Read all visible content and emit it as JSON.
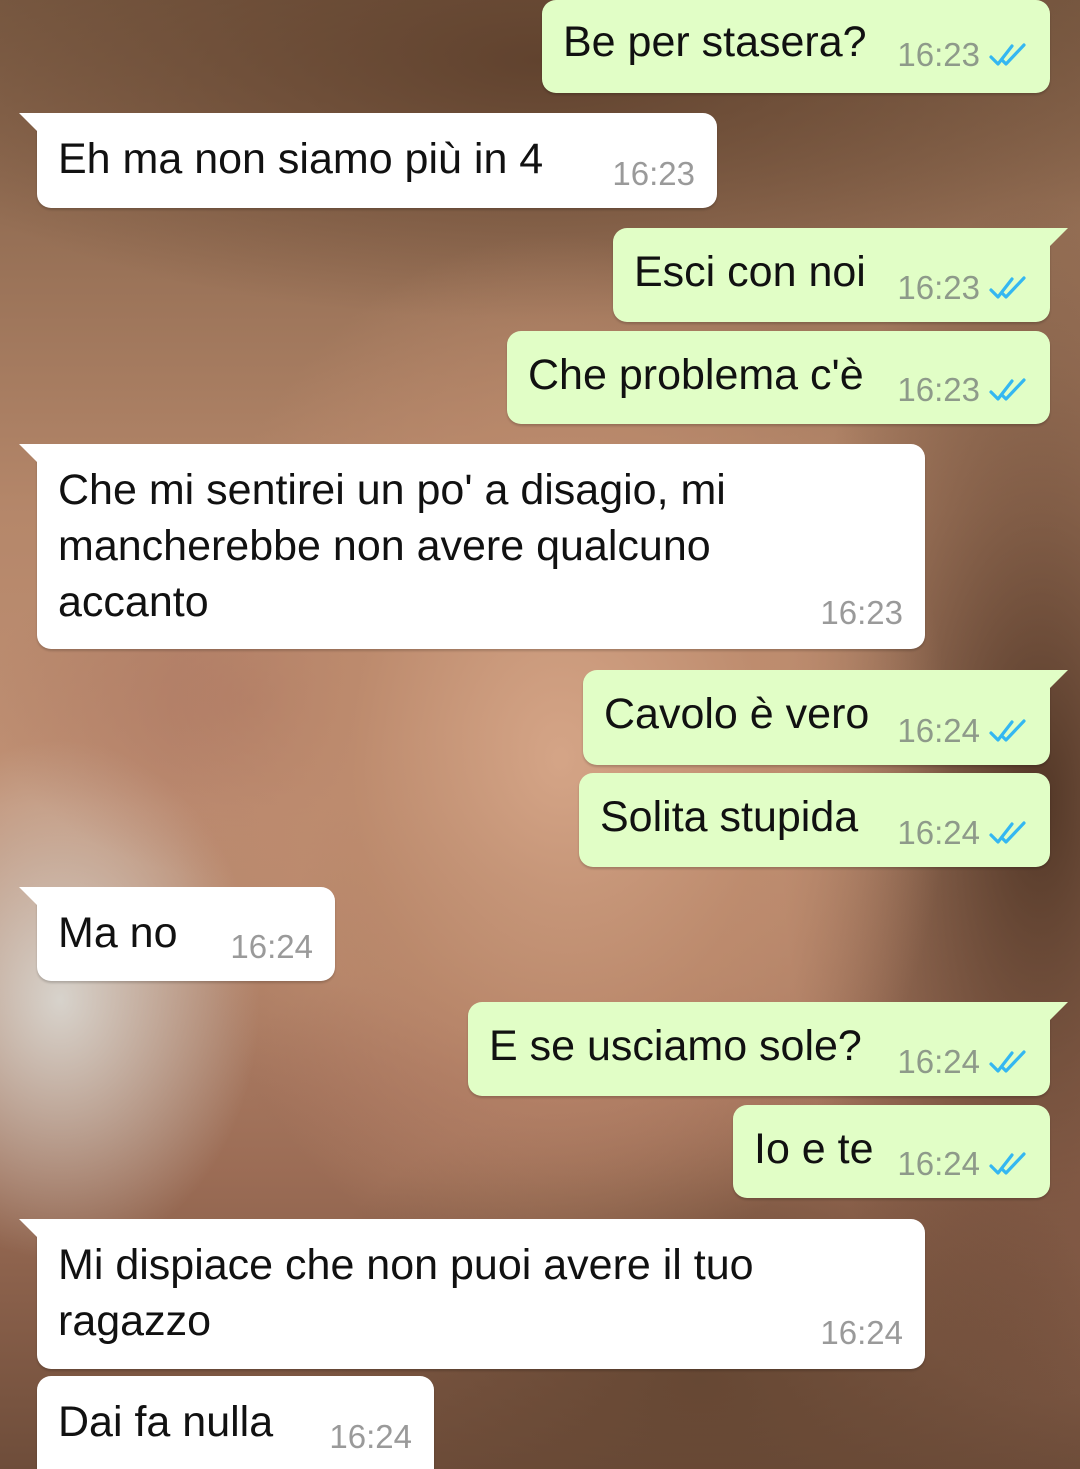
{
  "conversation": {
    "messages": [
      {
        "direction": "outgoing",
        "text": "Be per stasera?",
        "time": "16:23",
        "status": "read"
      },
      {
        "direction": "incoming",
        "text": "Eh ma non siamo più in 4",
        "time": "16:23"
      },
      {
        "direction": "outgoing",
        "text": "Esci con noi",
        "time": "16:23",
        "status": "read"
      },
      {
        "direction": "outgoing",
        "text": "Che problema c'è",
        "time": "16:23",
        "status": "read"
      },
      {
        "direction": "incoming",
        "text": "Che mi sentirei un po' a disagio, mi\nmancherebbe non avere qualcuno\naccanto",
        "time": "16:23"
      },
      {
        "direction": "outgoing",
        "text": "Cavolo è vero",
        "time": "16:24",
        "status": "read"
      },
      {
        "direction": "outgoing",
        "text": "Solita stupida",
        "time": "16:24",
        "status": "read"
      },
      {
        "direction": "incoming",
        "text": "Ma no",
        "time": "16:24"
      },
      {
        "direction": "outgoing",
        "text": "E se usciamo sole?",
        "time": "16:24",
        "status": "read"
      },
      {
        "direction": "outgoing",
        "text": "Io e te",
        "time": "16:24",
        "status": "read"
      },
      {
        "direction": "incoming",
        "text": "Mi dispiace che non puoi avere il tuo\nragazzo",
        "time": "16:24"
      },
      {
        "direction": "incoming",
        "text": "Dai fa nulla",
        "time": "16:24"
      }
    ]
  },
  "colors": {
    "outgoing_bubble": "#e1fec6",
    "incoming_bubble": "#ffffff",
    "read_ticks": "#34b7f1"
  },
  "icons": {
    "read_receipt": "double-check-icon"
  }
}
